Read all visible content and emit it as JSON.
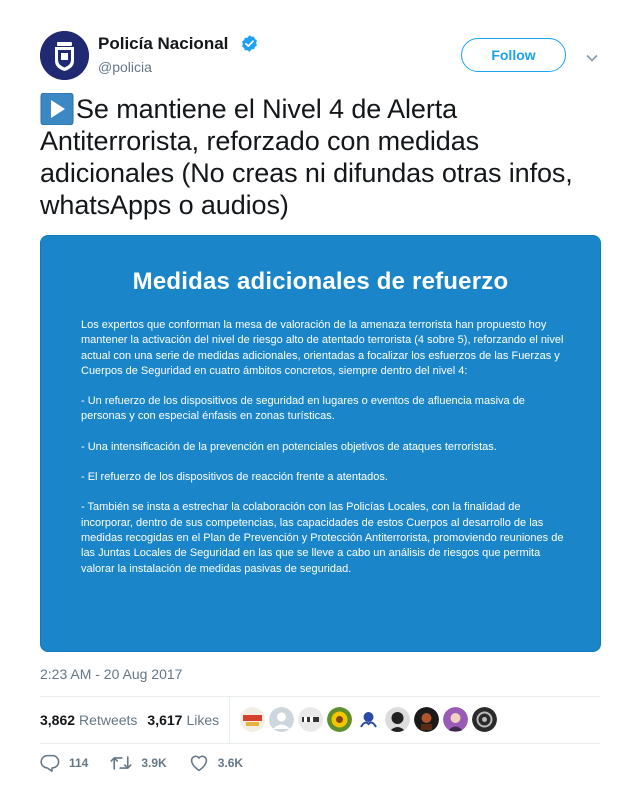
{
  "header": {
    "display_name": "Policía Nacional",
    "handle": "@policia",
    "follow_label": "Follow"
  },
  "tweet": {
    "text": "Se mantiene el Nivel 4 de Alerta Antiterrorista, reforzado con medidas adicionales (No creas ni difundas otras infos, whatsApps o audios)",
    "timestamp": "2:23 AM - 20 Aug 2017"
  },
  "media": {
    "title": "Medidas adicionales de refuerzo",
    "paragraphs": [
      "Los expertos que conforman la mesa de valoración de la amenaza terrorista han propuesto hoy mantener la activación del nivel de riesgo alto de atentado terrorista (4 sobre 5), reforzando el nivel actual con una serie de medidas adicionales, orientadas a focalizar los esfuerzos de las Fuerzas y Cuerpos de Seguridad en cuatro ámbitos concretos, siempre dentro del nivel 4:",
      "- Un refuerzo de los dispositivos de seguridad en lugares o eventos de afluencia masiva de personas y con especial énfasis en zonas turísticas.",
      "- Una intensificación de la prevención en potenciales objetivos de ataques terroristas.",
      "- El refuerzo de los dispositivos de reacción frente a atentados.",
      "- También se insta a estrechar la colaboración con las Policías Locales, con la finalidad de incorporar, dentro de sus competencias, las capacidades de estos Cuerpos al desarrollo de las medidas recogidas en el Plan de Prevención y Protección Antiterrorista, promoviendo reuniones de las Juntas Locales de Seguridad en las que se lleve a cabo un análisis de riesgos que permita valorar la instalación de medidas pasivas de seguridad."
    ]
  },
  "stats": {
    "retweets_count": "3,862",
    "retweets_label": "Retweets",
    "likes_count": "3,617",
    "likes_label": "Likes"
  },
  "actions": {
    "replies": "114",
    "retweets": "3.9K",
    "likes": "3.6K"
  },
  "colors": {
    "accent": "#1da1f2",
    "media_bg": "#1a86c9",
    "text": "#14171a",
    "muted": "#657786"
  }
}
